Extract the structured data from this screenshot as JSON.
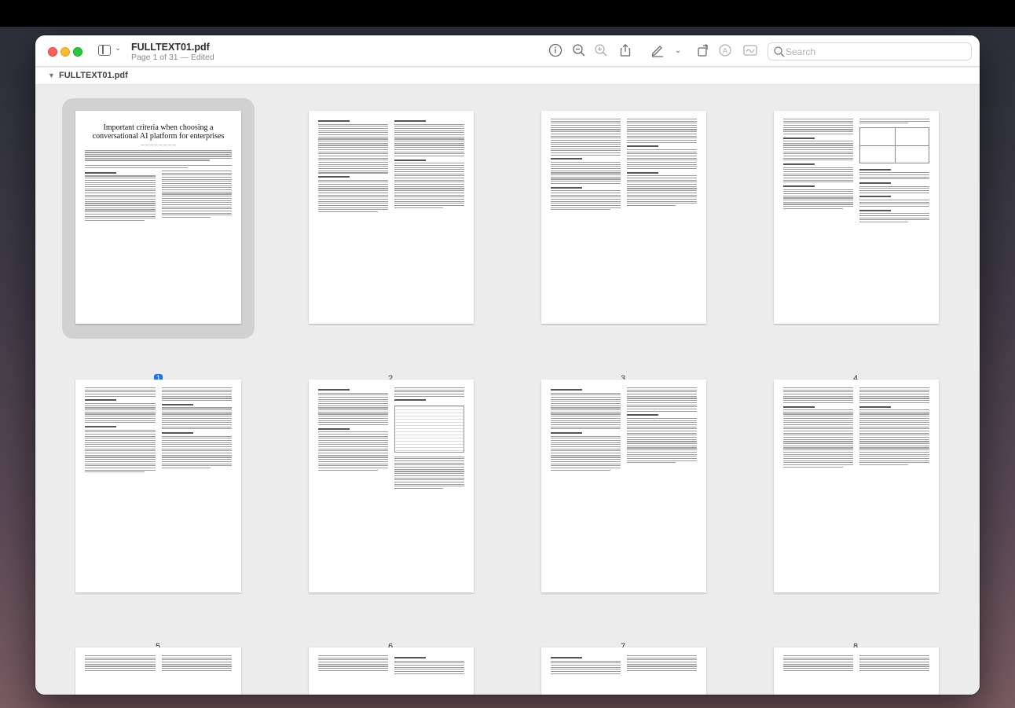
{
  "window": {
    "title": "FULLTEXT01.pdf",
    "subtitle": "Page 1 of 31 — Edited",
    "path_label": "FULLTEXT01.pdf"
  },
  "toolbar": {
    "icons": [
      "sidebar-icon",
      "info-icon",
      "zoom-out-icon",
      "zoom-in-icon",
      "share-icon",
      "markup-pen-icon",
      "rotate-icon",
      "form-fill-icon",
      "signature-icon",
      "search-icon"
    ]
  },
  "search": {
    "placeholder": "Search"
  },
  "selection_color": "#1f6fe8",
  "page1": {
    "title": "Important criteria when choosing a conversational AI platform for enterprises"
  },
  "pages": [
    {
      "num": "1",
      "selected": true
    },
    {
      "num": "2",
      "selected": false
    },
    {
      "num": "3",
      "selected": false
    },
    {
      "num": "4",
      "selected": false
    },
    {
      "num": "5",
      "selected": false
    },
    {
      "num": "6",
      "selected": false
    },
    {
      "num": "7",
      "selected": false
    },
    {
      "num": "8",
      "selected": false
    }
  ]
}
